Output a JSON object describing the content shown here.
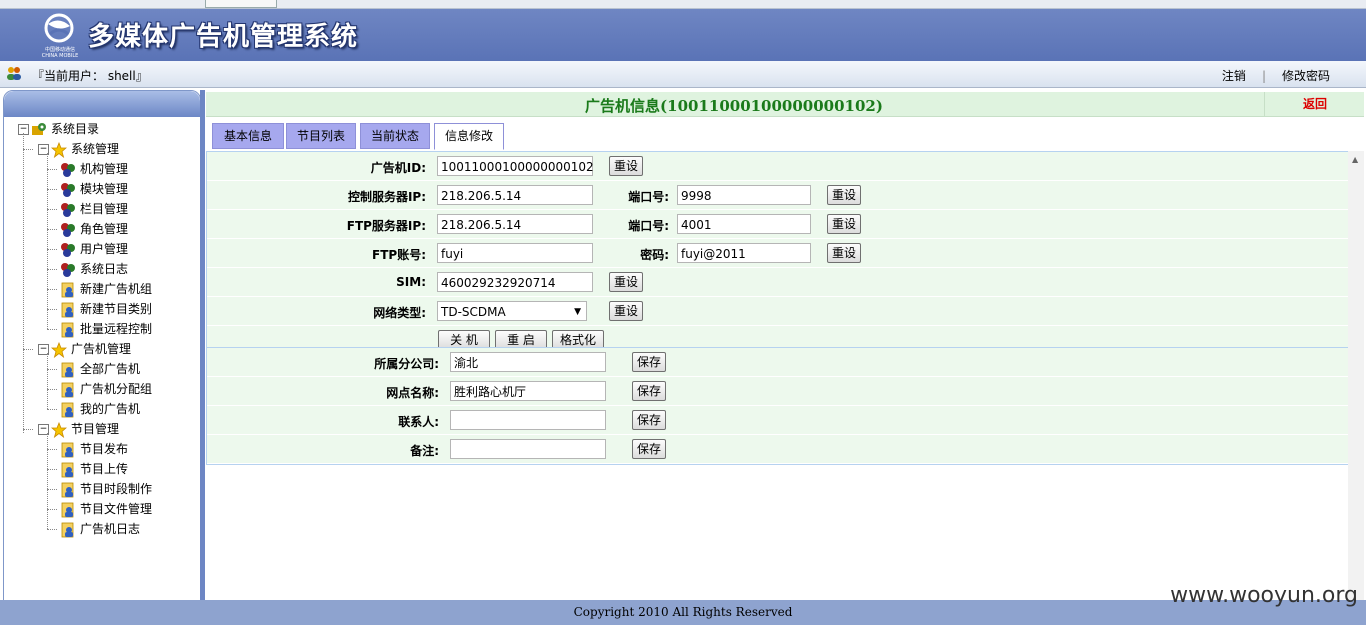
{
  "header": {
    "title": "多媒体广告机管理系统",
    "logo_text_cn": "中国移动通信",
    "logo_text_en": "CHINA MOBILE"
  },
  "userbar": {
    "current_user_label": "『当前用户： shell』",
    "logout": "注销",
    "change_password": "修改密码"
  },
  "tree": {
    "root": "系统目录",
    "groups": [
      {
        "label": "系统管理",
        "items": [
          "机构管理",
          "模块管理",
          "栏目管理",
          "角色管理",
          "用户管理",
          "系统日志",
          "新建广告机组",
          "新建节目类别",
          "批量远程控制"
        ]
      },
      {
        "label": "广告机管理",
        "items": [
          "全部广告机",
          "广告机分配组",
          "我的广告机"
        ]
      },
      {
        "label": "节目管理",
        "items": [
          "节目发布",
          "节目上传",
          "节目时段制作",
          "节目文件管理",
          "广告机日志"
        ]
      }
    ]
  },
  "main": {
    "title": "广告机信息(10011000100000000102)",
    "back": "返回",
    "tabs": [
      "基本信息",
      "节目列表",
      "当前状态",
      "信息修改"
    ],
    "active_tab": 3
  },
  "form": {
    "device_id_label": "广告机ID:",
    "device_id": "10011000100000000102",
    "ctrl_ip_label": "控制服务器IP:",
    "ctrl_ip": "218.206.5.14",
    "port_label": "端口号:",
    "ctrl_port": "9998",
    "ftp_ip_label": "FTP服务器IP:",
    "ftp_ip": "218.206.5.14",
    "ftp_port": "4001",
    "ftp_account_label": "FTP账号:",
    "ftp_account": "fuyi",
    "password_label": "密码:",
    "password": "fuyi@2011",
    "sim_label": "SIM:",
    "sim": "460029232920714",
    "network_label": "网络类型:",
    "network": "TD-SCDMA",
    "reset": "重设",
    "shutdown": "关 机",
    "restart": "重 启",
    "format": "格式化"
  },
  "form2": {
    "branch_label": "所属分公司:",
    "branch": "渝北",
    "site_label": "网点名称:",
    "site": "胜利路心机厅",
    "contact_label": "联系人:",
    "contact": "",
    "note_label": "备注:",
    "note": "",
    "save": "保存"
  },
  "footer": {
    "copyright": "Copyright 2010 All Rights Reserved",
    "watermark": "www.wooyun.org"
  },
  "colors": {
    "banner": "#5a73b6",
    "title_green": "#1a7a1a",
    "form_bg": "#edf9ed",
    "tab": "#a6a8ee",
    "back_red": "#dd0000"
  }
}
